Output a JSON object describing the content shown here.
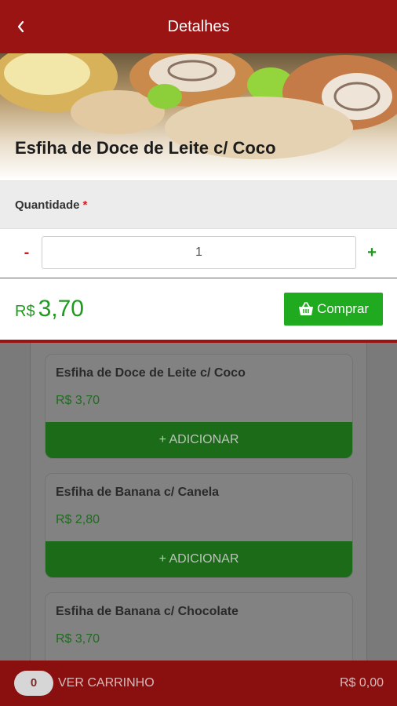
{
  "header": {
    "title": "Detalhes",
    "back_icon": "chevron-left-icon"
  },
  "product": {
    "title": "Esfiha de Doce de Leite c/ Coco",
    "quantity_label": "Quantidade",
    "required_mark": "*",
    "quantity_minus": "-",
    "quantity_value": "1",
    "quantity_plus": "+",
    "price_currency": "R$",
    "price_value": "3,70",
    "buy_label": "Comprar",
    "buy_icon": "basket-icon"
  },
  "list": {
    "items": [
      {
        "name": "Esfiha de Doce de Leite c/ Coco",
        "price": "R$ 3,70",
        "add_label": "+ ADICIONAR"
      },
      {
        "name": "Esfiha de Banana c/ Canela",
        "price": "R$ 2,80",
        "add_label": "+ ADICIONAR"
      },
      {
        "name": "Esfiha de Banana c/ Chocolate",
        "price": "R$ 3,70",
        "add_label": ""
      }
    ]
  },
  "footer": {
    "cart_count": "0",
    "cart_label": "VER CARRINHO",
    "cart_total": "R$ 0,00"
  },
  "colors": {
    "brand_red": "#9a1414",
    "accent_green": "#1faa1f",
    "required_red": "#d21e1e"
  }
}
